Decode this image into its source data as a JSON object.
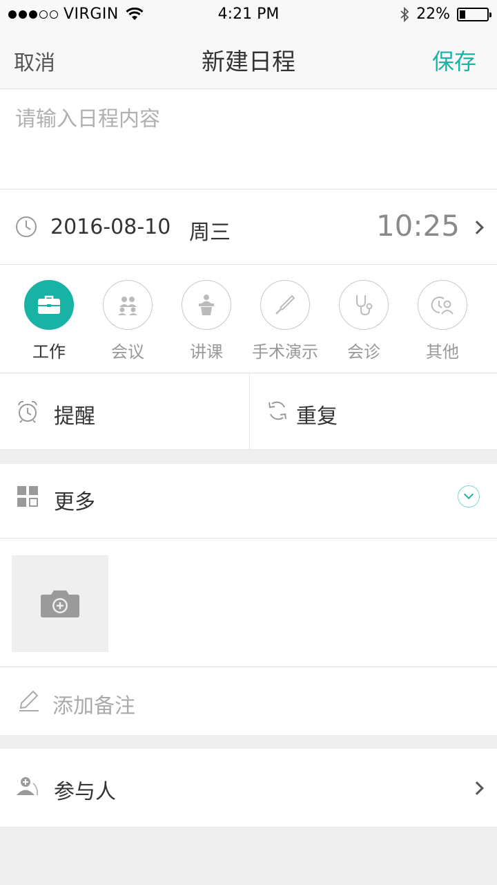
{
  "status_bar": {
    "carrier": "VIRGIN",
    "time": "4:21 PM",
    "battery_text": "22%",
    "battery_level": 0.22
  },
  "nav": {
    "cancel": "取消",
    "title": "新建日程",
    "save": "保存"
  },
  "content": {
    "placeholder": "请输入日程内容"
  },
  "datetime": {
    "date": "2016-08-10",
    "weekday": "周三",
    "time": "10:25"
  },
  "types": [
    {
      "label": "工作",
      "icon": "briefcase-icon",
      "active": true
    },
    {
      "label": "会议",
      "icon": "meeting-icon",
      "active": false
    },
    {
      "label": "讲课",
      "icon": "lecture-icon",
      "active": false
    },
    {
      "label": "手术演示",
      "icon": "scalpel-icon",
      "active": false
    },
    {
      "label": "会诊",
      "icon": "stethoscope-icon",
      "active": false
    },
    {
      "label": "其他",
      "icon": "other-icon",
      "active": false
    }
  ],
  "remind": {
    "label": "提醒"
  },
  "repeat": {
    "label": "重复"
  },
  "more": {
    "label": "更多"
  },
  "note": {
    "label": "添加备注"
  },
  "participants": {
    "label": "参与人"
  },
  "colors": {
    "accent": "#19b3a6"
  }
}
